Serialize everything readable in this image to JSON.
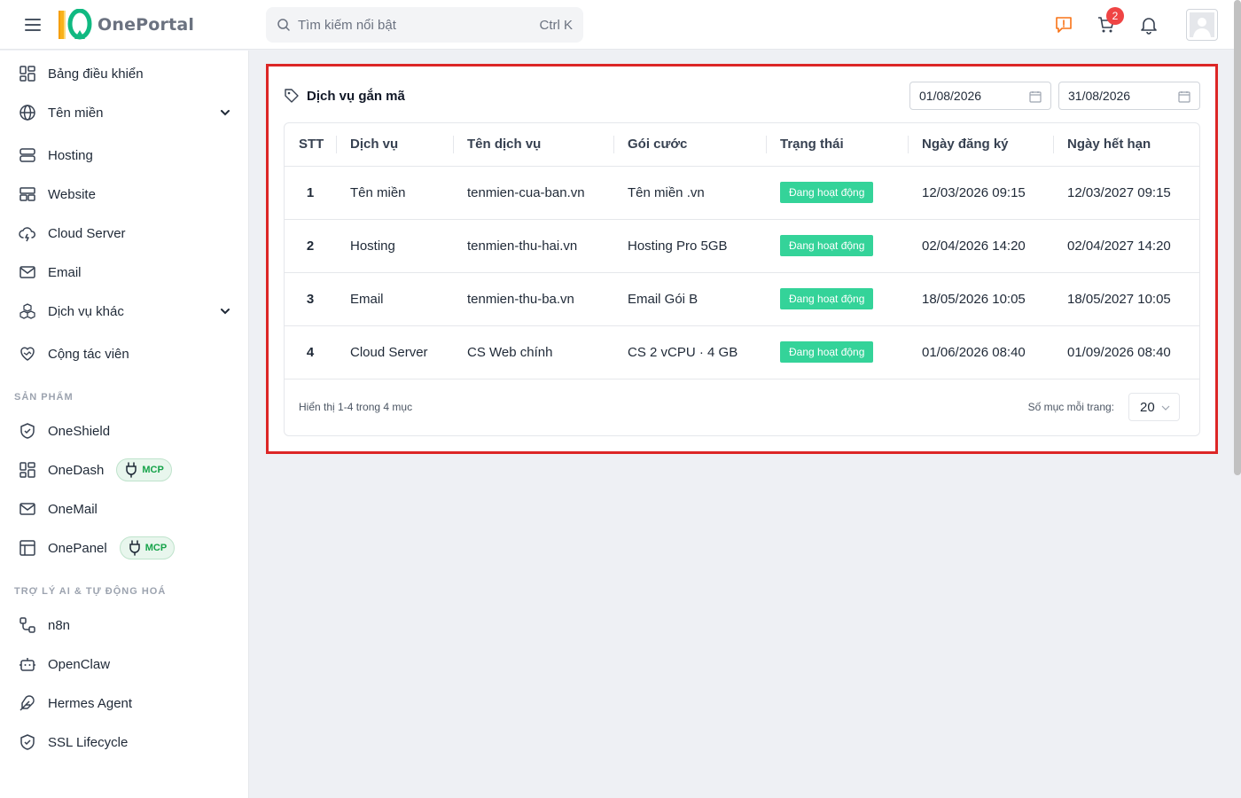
{
  "header": {
    "logo_text": "OnePortal",
    "search_placeholder": "Tìm kiếm nổi bật",
    "search_shortcut": "Ctrl K",
    "cart_count": "2"
  },
  "sidebar": {
    "items": [
      {
        "label": "Bảng điều khiển",
        "icon": "dashboard-icon"
      },
      {
        "label": "Tên miền",
        "icon": "globe-icon",
        "expandable": true
      },
      {
        "label": "Hosting",
        "icon": "server-icon"
      },
      {
        "label": "Website",
        "icon": "website-icon"
      },
      {
        "label": "Cloud Server",
        "icon": "cloud-icon"
      },
      {
        "label": "Email",
        "icon": "mail-icon"
      },
      {
        "label": "Dịch vụ khác",
        "icon": "boxes-icon",
        "expandable": true
      },
      {
        "label": "Cộng tác viên",
        "icon": "handshake-heart-icon"
      }
    ],
    "section_products": "SẢN PHẨM",
    "products": [
      {
        "label": "OneShield",
        "icon": "shield-icon"
      },
      {
        "label": "OneDash",
        "icon": "dashboard-icon",
        "badge": "MCP"
      },
      {
        "label": "OneMail",
        "icon": "mail-icon"
      },
      {
        "label": "OnePanel",
        "icon": "panel-icon",
        "badge": "MCP"
      }
    ],
    "section_ai": "TRỢ LÝ AI & TỰ ĐỘNG HOÁ",
    "ai_items": [
      {
        "label": "n8n",
        "icon": "workflow-icon"
      },
      {
        "label": "OpenClaw",
        "icon": "bot-icon"
      },
      {
        "label": "Hermes Agent",
        "icon": "feather-icon"
      },
      {
        "label": "SSL Lifecycle",
        "icon": "shield-check-icon"
      }
    ]
  },
  "card": {
    "title": "Dịch vụ gắn mã",
    "date_from": "01/08/2026",
    "date_to": "31/08/2026",
    "columns": [
      "STT",
      "Dịch vụ",
      "Tên dịch vụ",
      "Gói cước",
      "Trạng thái",
      "Ngày đăng ký",
      "Ngày hết hạn"
    ],
    "rows": [
      {
        "stt": "1",
        "service": "Tên miền",
        "name": "tenmien-cua-ban.vn",
        "plan": "Tên miền .vn",
        "status": "Đang hoạt động",
        "registered": "12/03/2026 09:15",
        "expires": "12/03/2027 09:15"
      },
      {
        "stt": "2",
        "service": "Hosting",
        "name": "tenmien-thu-hai.vn",
        "plan": "Hosting Pro 5GB",
        "status": "Đang hoạt động",
        "registered": "02/04/2026 14:20",
        "expires": "02/04/2027 14:20"
      },
      {
        "stt": "3",
        "service": "Email",
        "name": "tenmien-thu-ba.vn",
        "plan": "Email Gói B",
        "status": "Đang hoạt động",
        "registered": "18/05/2026 10:05",
        "expires": "18/05/2027 10:05"
      },
      {
        "stt": "4",
        "service": "Cloud Server",
        "name": "CS Web chính",
        "plan": "CS 2 vCPU · 4 GB",
        "status": "Đang hoạt động",
        "registered": "01/06/2026 08:40",
        "expires": "01/09/2026 08:40"
      }
    ],
    "footer_count": "Hiển thị 1-4 trong 4 mục",
    "per_page_label": "Số mục mỗi trang:",
    "per_page_value": "20"
  },
  "colors": {
    "accent_outline": "#dc2626",
    "status_green": "#34d399",
    "badge_red": "#ef4444",
    "mcp_green": "#16a34a"
  }
}
